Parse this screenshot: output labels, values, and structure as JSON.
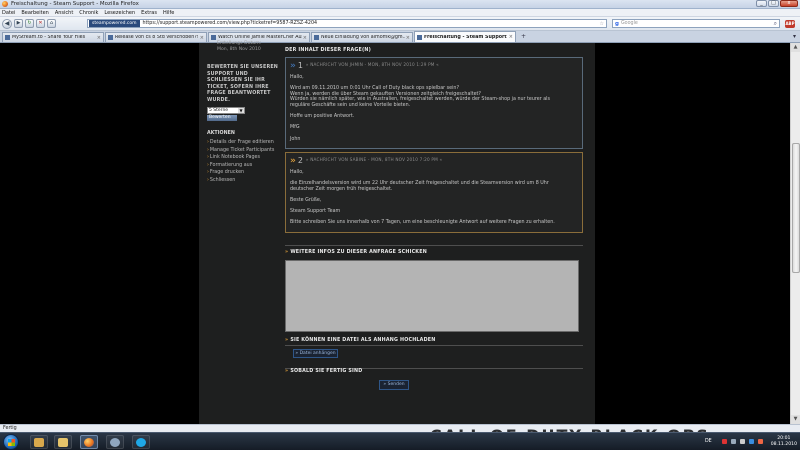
{
  "window": {
    "title": "Freischaltung - Steam Support - Mozilla Firefox",
    "min": "_",
    "max": "□",
    "close": "x"
  },
  "menu": [
    "Datei",
    "Bearbeiten",
    "Ansicht",
    "Chronik",
    "Lesezeichen",
    "Extras",
    "Hilfe"
  ],
  "nav": {
    "back": "◀",
    "forward": "▶",
    "reload": "↻",
    "stop": "✕",
    "home": "⌂",
    "site_badge": "steampowered.com",
    "url": "https://support.steampowered.com/view.php?ticketref=9587-RZSZ-4204",
    "search_engine": "g",
    "search_placeholder": "Google"
  },
  "tabs": [
    {
      "label": "MyStream.to - Share Your Files",
      "active": false
    },
    {
      "label": "Release von cs 8 Std verschoben?!?...",
      "active": false
    },
    {
      "label": "Watch Online Jamie MasterChef Aus...",
      "active": false
    },
    {
      "label": "Neue Einladung von almomk@gm...",
      "active": false
    },
    {
      "label": "Freischaltung - Steam Support",
      "active": true
    }
  ],
  "tab_controls": {
    "new": "+",
    "list": "▾"
  },
  "left": {
    "ticket_date_top": "Erstellungs-Datum:",
    "ticket_date": "Mon, 8th Nov 2010",
    "rate_text": "BEWERTEN SIE UNSEREN SUPPORT UND SCHLIESSEN SIE IHR TICKET, SOFERN IHRE FRAGE BEANTWORTET WURDE.",
    "rate_select": "5 Sterne",
    "rate_button": "Bewerten",
    "actions_title": "AKTIONEN",
    "actions": [
      "Details der Frage editieren",
      "Manage Ticket Participants",
      "Link Notebook Pages",
      "Formatierung aus",
      "Frage drucken",
      "Schliessen"
    ]
  },
  "main": {
    "content_title": "DER INHALT DIESER FRAGE(N)",
    "messages": [
      {
        "num": "1",
        "meta": "» NACHRICHT VON JHMIN - MON, 8TH NOV 2010 1:29 PM «",
        "lines": [
          "Hallo,",
          "",
          "Wird am 09.11.2010 um 0:01 Uhr Call of Duty black ops spielbar sein?",
          "Wenn ja, werden die über Steam gekauften Versionen zeitgleich freigeschaltet?",
          "Würden sie nämlich später, wie in Australien, freigeschaltet werden, würde der Steam-shop ja nur teurer als",
          "reguläre Geschäfte sein und keine Vorteile bieten.",
          "",
          "Hoffe um positive Antwort.",
          "",
          "MfG",
          "",
          "John"
        ]
      },
      {
        "num": "2",
        "meta": "» NACHRICHT VON SABINE - MON, 8TH NOV 2010 7:20 PM «",
        "lines": [
          "Hallo,",
          "",
          "die Einzelhandelsversion wird um 22 Uhr deutscher Zeit freigeschaltet und die Steamversion wird um 8 Uhr",
          "deutscher Zeit morgen früh freigeschaltet.",
          "",
          "Beste Grüße,",
          "",
          "Steam Support Team",
          "",
          "Bitte schreiben Sie uns innerhalb von 7 Tagen, um eine beschleunigte Antwort auf weitere Fragen zu erhalten."
        ]
      }
    ],
    "reply_title": "WEITERE INFOS ZU DIESER ANFRAGE SCHICKEN",
    "attach_title": "SIE KÖNNEN EINE DATEI ALS ANHANG HOCHLADEN",
    "attach_button": "» Datei anhängen",
    "done_title": "SOBALD SIE FERTIG SIND",
    "submit_button": "» Senden"
  },
  "status": {
    "text": "Fertig"
  },
  "taskbar": {
    "lang": "DE",
    "time": "20:01",
    "date": "08.11.2010",
    "background_text": "CALL OF DUTY BLACK OPS"
  },
  "colors": {
    "accent_orange": "#d89a3a",
    "accent_blue": "#3f6ea8",
    "page_bg": "#1e1f1f"
  }
}
